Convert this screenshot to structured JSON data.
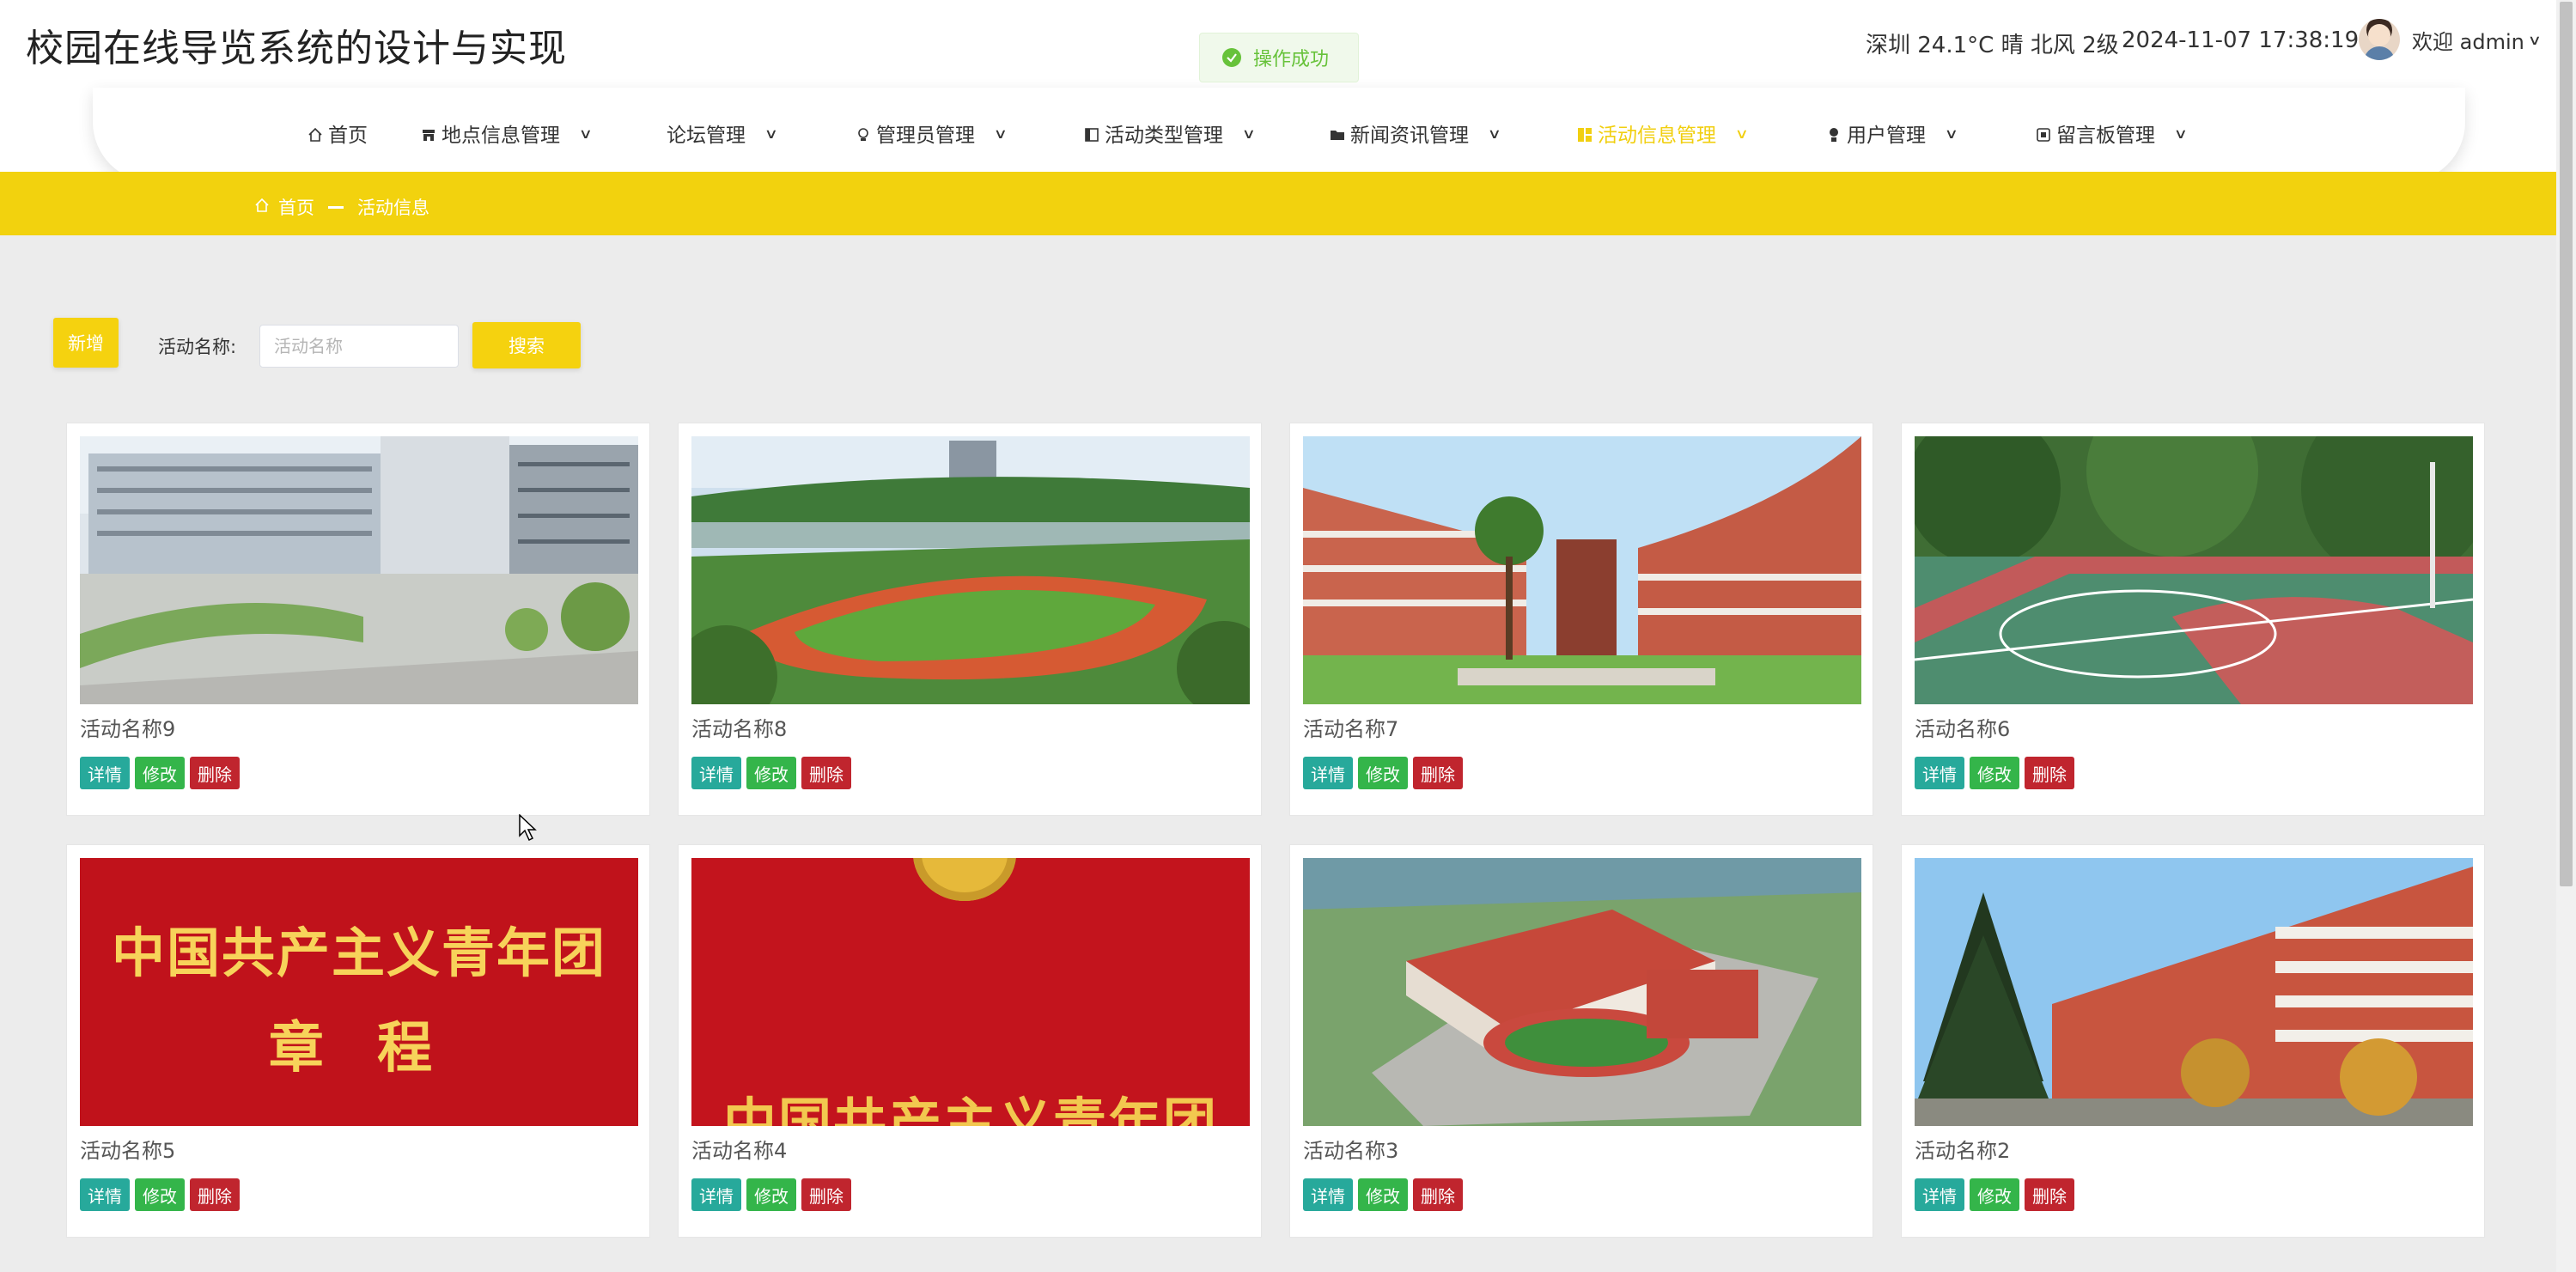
{
  "app": {
    "title": "校园在线导览系统的设计与实现"
  },
  "toast": {
    "text": "操作成功"
  },
  "header": {
    "weather": "深圳 24.1°C 晴 北风 2级",
    "datetime": "2024-11-07 17:38:19",
    "welcome": "欢迎 admin"
  },
  "nav": {
    "items": [
      {
        "label": "首页",
        "icon": "home-icon"
      },
      {
        "label": "地点信息管理",
        "icon": "shop-icon"
      },
      {
        "label": "论坛管理",
        "icon": ""
      },
      {
        "label": "管理员管理",
        "icon": "bulb-icon"
      },
      {
        "label": "活动类型管理",
        "icon": "panel-icon"
      },
      {
        "label": "新闻资讯管理",
        "icon": "folder-icon"
      },
      {
        "label": "活动信息管理",
        "icon": "grid-icon",
        "active": true
      },
      {
        "label": "用户管理",
        "icon": "user-icon"
      },
      {
        "label": "留言板管理",
        "icon": "chip-icon"
      }
    ]
  },
  "breadcrumb": {
    "home": "首页",
    "current": "活动信息"
  },
  "toolbar": {
    "add_label": "新增",
    "search_label": "活动名称:",
    "search_placeholder": "活动名称",
    "search_button": "搜索"
  },
  "cards": [
    {
      "name": "活动名称9",
      "image": "modern-campus-building"
    },
    {
      "name": "活动名称8",
      "image": "sports-field"
    },
    {
      "name": "活动名称7",
      "image": "courtyard-buildings"
    },
    {
      "name": "活动名称6",
      "image": "basketball-court"
    },
    {
      "name": "活动名称5",
      "image": "red-book-cover",
      "image_text": [
        "中国共产主义青年团",
        "章 程"
      ]
    },
    {
      "name": "活动名称4",
      "image": "red-emblem-cover",
      "image_text": [
        "中国共产主义青年团"
      ]
    },
    {
      "name": "活动名称3",
      "image": "aerial-campus"
    },
    {
      "name": "活动名称2",
      "image": "campus-trees"
    }
  ],
  "card_actions": {
    "detail": "详情",
    "edit": "修改",
    "delete": "删除"
  },
  "colors": {
    "accent": "#f2d20e",
    "detail": "#27a99b",
    "edit": "#34b54a",
    "delete": "#c0252e",
    "success": "#67c23a"
  }
}
